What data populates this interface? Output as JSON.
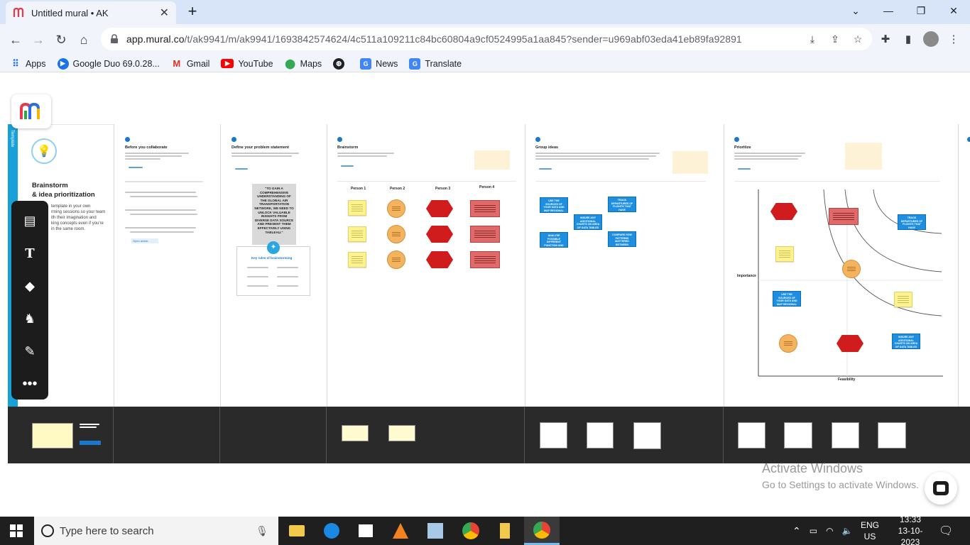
{
  "browser": {
    "tab_title": "Untitled mural • AK",
    "tab_close": "✕",
    "new_tab": "+",
    "url_host": "app.mural.co",
    "url_path": "/t/ak9941/m/ak9941/1693842574624/4c511a109211c84bc60804a9cf0524995a1aa845?sender=u969abf03eda41eb89fa92891",
    "bookmarks": [
      {
        "label": "Apps",
        "icon": "apps-grid-icon"
      },
      {
        "label": "Google Duo 69.0.28...",
        "icon": "duo-icon"
      },
      {
        "label": "Gmail",
        "icon": "gmail-icon"
      },
      {
        "label": "YouTube",
        "icon": "youtube-icon"
      },
      {
        "label": "Maps",
        "icon": "maps-icon"
      },
      {
        "label": "",
        "icon": "globe-icon"
      },
      {
        "label": "News",
        "icon": "news-icon"
      },
      {
        "label": "Translate",
        "icon": "translate-icon"
      }
    ]
  },
  "mural": {
    "intro": {
      "title_line1": "Brainstorm",
      "title_line2": "& idea prioritization",
      "text1": "template in your own",
      "text2": "rming sessions so your team",
      "text3": "ith their imagination and",
      "text4": "king concepts even if you're",
      "text5": "in the same room."
    },
    "sections": [
      {
        "title": "Before you collaborate"
      },
      {
        "title": "Define your problem statement"
      },
      {
        "title": "Brainstorm"
      },
      {
        "title": "Group ideas"
      },
      {
        "title": "Prioritize"
      }
    ],
    "open_article": "Open article",
    "problem_statement": "\"TO GAIN A COMPREHENSIVE UNDERSTANDING OF THE GLOBAL AIR TRANSPORTATION NETWORK, WE NEED TO UNLOCK VALUABLE INSIGHTS FROM DIVERSE DATA SOURCE AND PRESENT THEM EFFECTIVELY USING TABLEAU.\"",
    "key_rules": "Key rules of brainstorming",
    "persons": [
      "Person 1",
      "Person 2",
      "Person 3",
      "Person 4"
    ],
    "group_cards": [
      "USE THE SOURCES OF YOUR DATA AND MAP REGIONAL OR CHALLENGE RANKINGS",
      "TRACK DEPARTURES OF FLIGHTS THAT HAVE MAINTENANCE TO YOUR REGION",
      "INSURE ANY ADDITIONAL CHARTS ON AREA OF DATA TABLES FOR REGIONS",
      "ANALYSE POSSIBLE DIFFERENT FUNCTION AND DATABASE OF DATA WITHIN RANKINGS",
      "COMPARE HOW PATTERNS MATTERED BETWEEN DIFFERENT REGIONS"
    ],
    "axis_importance": "Importance",
    "axis_feasibility": "Feasibility"
  },
  "overlay": {
    "activate_title": "Activate Windows",
    "activate_sub": "Go to Settings to activate Windows."
  },
  "taskbar": {
    "search_placeholder": "Type here to search",
    "lang": "ENG",
    "region": "US",
    "time": "13:33",
    "date": "13-10-2023"
  },
  "colors": {
    "mural_accent": "#e8394a",
    "cyan": "#18a0d8",
    "sticky_yellow": "#fdf38e",
    "card_blue": "#1d8ee0",
    "hex_red": "#d01c1c"
  }
}
